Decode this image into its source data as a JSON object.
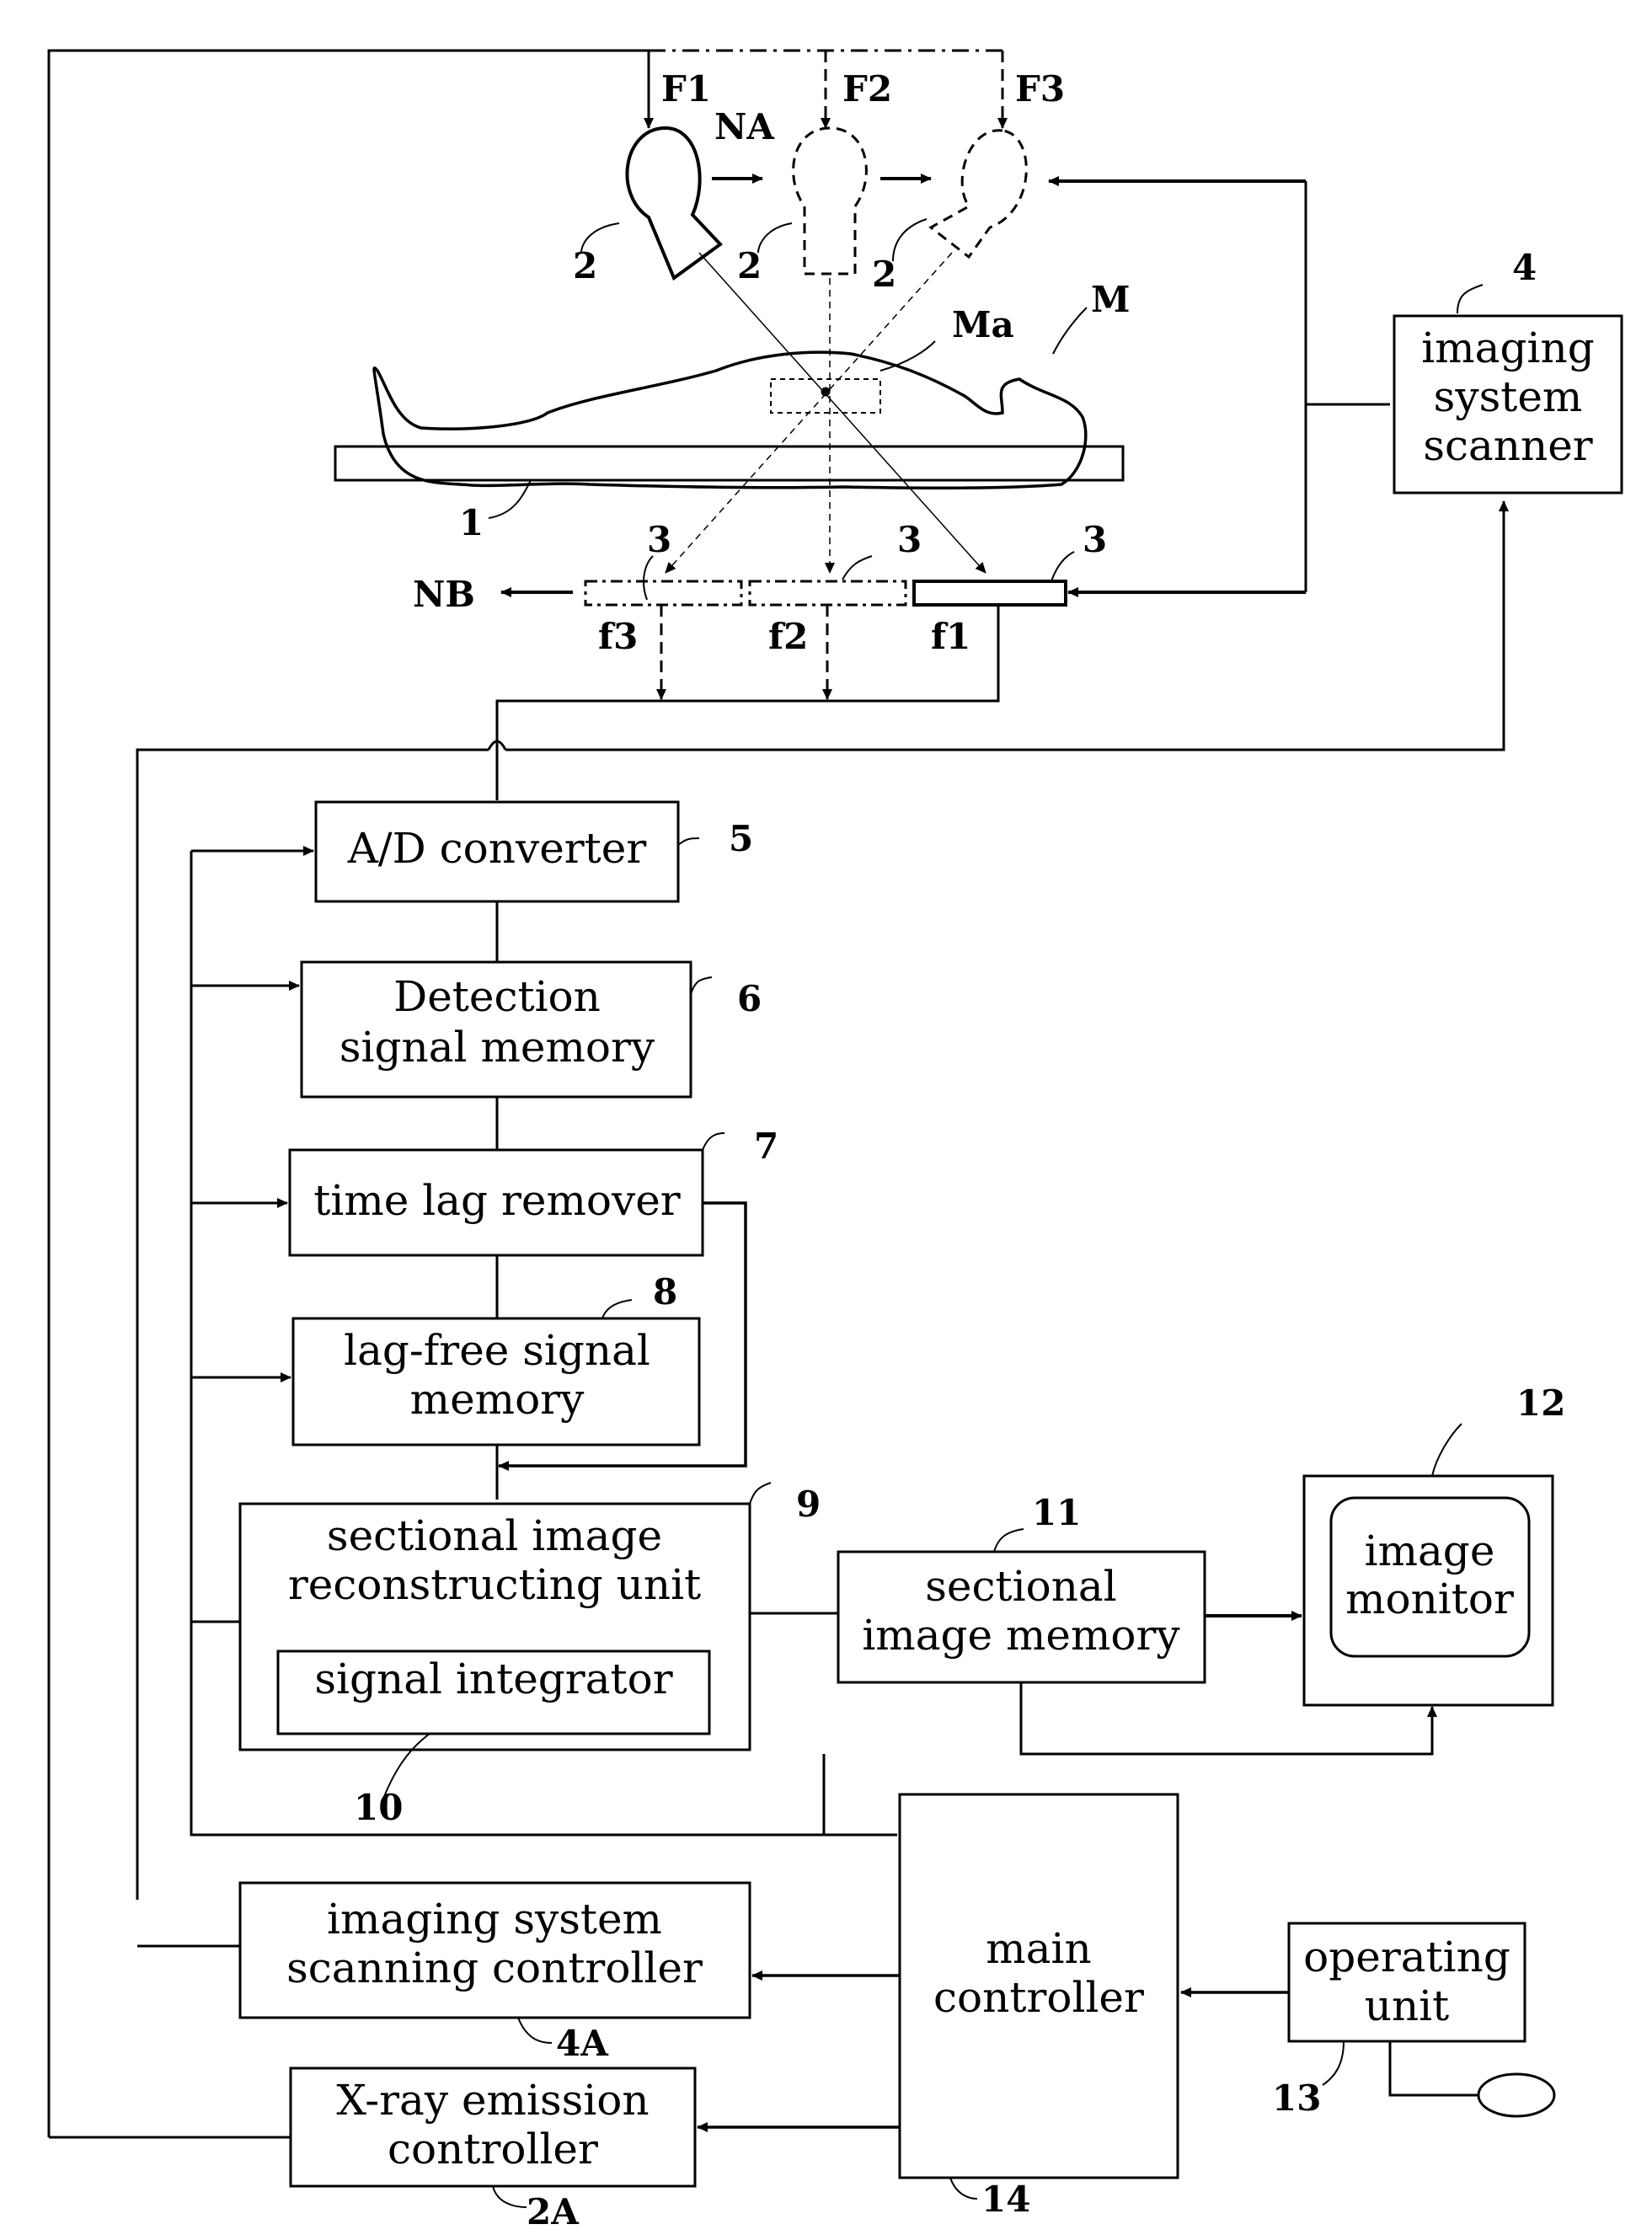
{
  "figure": {
    "top_labels": {
      "F1": "F1",
      "F2": "F2",
      "F3": "F3",
      "NA": "NA",
      "NB": "NB",
      "M": "M",
      "Ma": "Ma",
      "f1": "f1",
      "f2": "f2",
      "f3": "f3"
    },
    "refs": {
      "table": "1",
      "tube_1": "2",
      "tube_2": "2",
      "tube_3": "2",
      "det_1": "3",
      "det_2": "3",
      "det_3": "3",
      "scanner": "4",
      "ad": "5",
      "detmem": "6",
      "lagrem": "7",
      "lagfree": "8",
      "recon": "9",
      "integrator": "10",
      "secmem": "11",
      "monitor": "12",
      "operating": "13",
      "main": "14",
      "scanctrl": "4A",
      "xrayctrl": "2A"
    },
    "blocks": {
      "scanner": [
        "imaging",
        "system",
        "scanner"
      ],
      "ad": [
        "A/D converter"
      ],
      "detmem": [
        "Detection",
        "signal memory"
      ],
      "lagrem": [
        "time lag remover"
      ],
      "lagfree": [
        "lag-free signal",
        "memory"
      ],
      "recon": [
        "sectional image",
        "reconstructing unit"
      ],
      "integrator": [
        "signal integrator"
      ],
      "secmem": [
        "sectional",
        "image memory"
      ],
      "monitor": [
        "image",
        "monitor"
      ],
      "scanctrl": [
        "imaging system",
        "scanning controller"
      ],
      "main": [
        "main",
        "controller"
      ],
      "operating": [
        "operating",
        "unit"
      ],
      "xrayctrl": [
        "X-ray emission",
        "controller"
      ]
    }
  }
}
